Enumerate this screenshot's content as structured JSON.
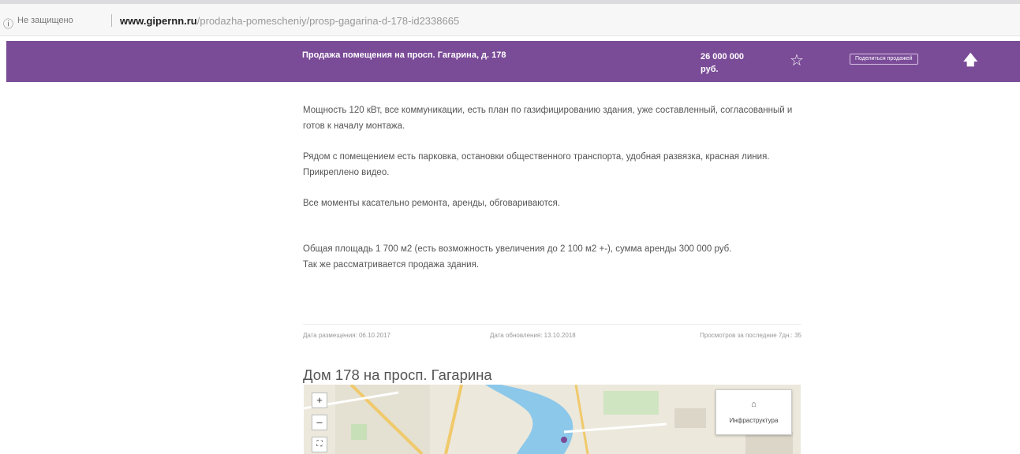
{
  "address_bar": {
    "info_icon": "ⓘ",
    "security": "Не защищено",
    "url_host": "www.gipernn.ru",
    "url_path": "/prodazha-pomescheniy/prosp-gagarina-d-178-id2338665"
  },
  "header": {
    "title": "Продажа помещения на просп. Гагарина, д. 178",
    "price": "26 000 000 руб.",
    "favorite_icon": "star-outline-icon",
    "share_label": "Поделиться продажей",
    "scroll_top_icon": "arrow-up-icon",
    "background": "#7a4b97"
  },
  "description": {
    "p1": "Мощность 120 кВт, все коммуникации, есть план по газифицированию здания, уже составленный, согласованный и готов к началу монтажа.",
    "p2a": "Рядом с помещением есть парковка, остановки общественного транспорта, удобная развязка, красная линия.",
    "p2b": "Прикреплено видео.",
    "p3": "Все моменты касательно ремонта, аренды, обговариваются.",
    "p4a": "Общая площадь 1 700 м2 (есть возможность увеличения до 2 100 м2 +-), сумма аренды 300 000 руб.",
    "p4b": "Так же рассматривается продажа здания."
  },
  "meta": {
    "posted": "Дата размещения: 06.10.2017",
    "updated": "Дата обновления: 13.10.2018",
    "views": "Просмотров за последние 7дн.: 35"
  },
  "map_section": {
    "title": "Дом 178 на просп. Гагарина",
    "zoom_in": "+",
    "zoom_out": "–",
    "fullscreen": "⛶",
    "infra_icon": "building-icon",
    "infra_label": "Инфраструктура"
  }
}
